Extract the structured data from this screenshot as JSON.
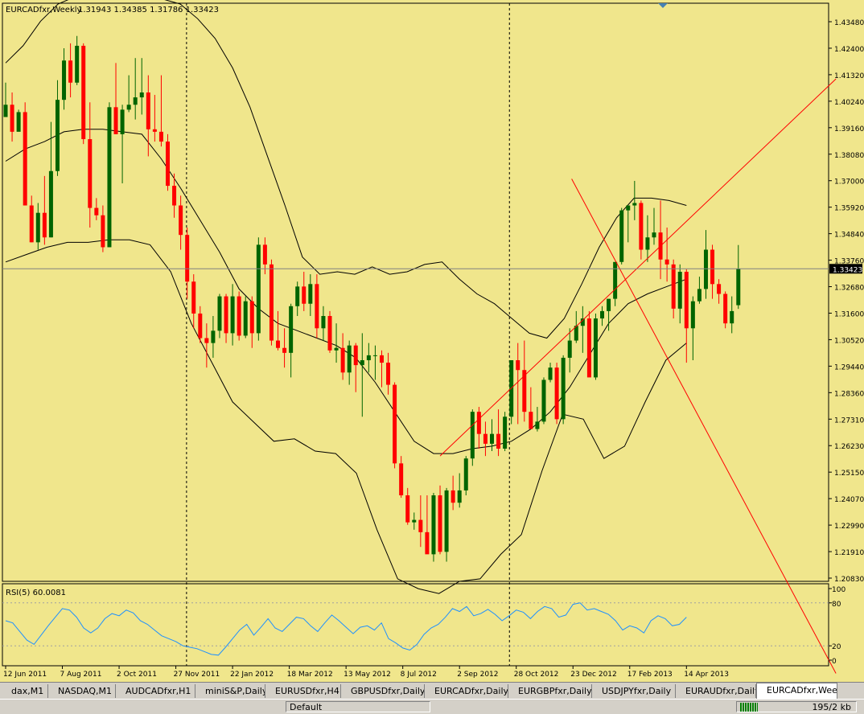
{
  "chart_header": {
    "symbol_text": "EURCADfxr,Weekly",
    "ohlc_text": "1.31943 1.34385 1.31786 1.33423"
  },
  "rsi_header": {
    "text": "RSI(5) 60.0081"
  },
  "current_price_label": "1.33423",
  "price_ticks": [
    "1.43480",
    "1.42400",
    "1.41320",
    "1.40240",
    "1.39160",
    "1.38080",
    "1.37000",
    "1.35920",
    "1.34840",
    "1.33760",
    "1.32680",
    "1.31600",
    "1.30520",
    "1.29440",
    "1.28360",
    "1.27310",
    "1.26230",
    "1.25150",
    "1.24070",
    "1.22990",
    "1.21910",
    "1.20830"
  ],
  "rsi_ticks": [
    "100",
    "80",
    "20",
    "0"
  ],
  "date_ticks": [
    "12 Jun 2011",
    "7 Aug 2011",
    "2 Oct 2011",
    "27 Nov 2011",
    "22 Jan 2012",
    "18 Mar 2012",
    "13 May 2012",
    "8 Jul 2012",
    "2 Sep 2012",
    "28 Oct 2012",
    "23 Dec 2012",
    "17 Feb 2013",
    "14 Apr 2013"
  ],
  "tabs": [
    "dax,M1",
    "NASDAQ,M1",
    "AUDCADfxr,H1",
    "miniS&P,Daily",
    "EURUSDfxr,H4",
    "GBPUSDfxr,Daily",
    "EURCADfxr,Daily",
    "EURGBPfxr,Daily",
    "USDJPYfxr,Daily",
    "EURAUDfxr,Daily",
    "EURCADfxr,Weekly"
  ],
  "active_tab": 10,
  "status": {
    "profile": "Default",
    "traffic": "195/2 kb"
  },
  "colors": {
    "background": "#f0e68c",
    "bull": "#006400",
    "bear": "#ff0000",
    "band": "#000000",
    "trendline": "#ff0000",
    "rsi": "#1e90ff"
  },
  "chart_data": {
    "type": "candlestick",
    "timeframe": "Weekly",
    "symbol": "EURCADfxr",
    "ylim": [
      1.2083,
      1.4348
    ],
    "candles": [
      [
        1.396,
        1.41,
        1.396,
        1.401
      ],
      [
        1.401,
        1.406,
        1.386,
        1.39
      ],
      [
        1.39,
        1.399,
        1.392,
        1.398
      ],
      [
        1.398,
        1.402,
        1.36,
        1.36
      ],
      [
        1.36,
        1.364,
        1.345,
        1.345
      ],
      [
        1.345,
        1.361,
        1.342,
        1.357
      ],
      [
        1.357,
        1.372,
        1.344,
        1.347
      ],
      [
        1.347,
        1.394,
        1.347,
        1.374
      ],
      [
        1.374,
        1.411,
        1.372,
        1.403
      ],
      [
        1.403,
        1.424,
        1.399,
        1.419
      ],
      [
        1.419,
        1.426,
        1.404,
        1.41
      ],
      [
        1.41,
        1.429,
        1.409,
        1.425
      ],
      [
        1.425,
        1.426,
        1.385,
        1.387
      ],
      [
        1.387,
        1.402,
        1.351,
        1.359
      ],
      [
        1.359,
        1.363,
        1.354,
        1.356
      ],
      [
        1.356,
        1.36,
        1.341,
        1.343
      ],
      [
        1.343,
        1.402,
        1.343,
        1.4
      ],
      [
        1.4,
        1.418,
        1.389,
        1.389
      ],
      [
        1.389,
        1.401,
        1.369,
        1.399
      ],
      [
        1.399,
        1.413,
        1.398,
        1.401
      ],
      [
        1.401,
        1.42,
        1.395,
        1.404
      ],
      [
        1.404,
        1.42,
        1.397,
        1.406
      ],
      [
        1.406,
        1.413,
        1.38,
        1.391
      ],
      [
        1.391,
        1.405,
        1.386,
        1.39
      ],
      [
        1.39,
        1.413,
        1.384,
        1.386
      ],
      [
        1.386,
        1.389,
        1.366,
        1.368
      ],
      [
        1.368,
        1.373,
        1.355,
        1.36
      ],
      [
        1.36,
        1.364,
        1.342,
        1.348
      ],
      [
        1.348,
        1.351,
        1.322,
        1.329
      ],
      [
        1.329,
        1.332,
        1.31,
        1.316
      ],
      [
        1.316,
        1.319,
        1.304,
        1.306
      ],
      [
        1.306,
        1.312,
        1.294,
        1.304
      ],
      [
        1.304,
        1.315,
        1.298,
        1.309
      ],
      [
        1.309,
        1.324,
        1.306,
        1.323
      ],
      [
        1.323,
        1.324,
        1.304,
        1.308
      ],
      [
        1.308,
        1.328,
        1.303,
        1.323
      ],
      [
        1.323,
        1.325,
        1.305,
        1.307
      ],
      [
        1.307,
        1.323,
        1.306,
        1.321
      ],
      [
        1.321,
        1.323,
        1.302,
        1.308
      ],
      [
        1.308,
        1.347,
        1.305,
        1.344
      ],
      [
        1.344,
        1.347,
        1.332,
        1.336
      ],
      [
        1.336,
        1.338,
        1.303,
        1.305
      ],
      [
        1.305,
        1.317,
        1.301,
        1.302
      ],
      [
        1.302,
        1.31,
        1.294,
        1.3
      ],
      [
        1.3,
        1.32,
        1.29,
        1.319
      ],
      [
        1.319,
        1.329,
        1.315,
        1.327
      ],
      [
        1.327,
        1.333,
        1.317,
        1.32
      ],
      [
        1.32,
        1.332,
        1.315,
        1.328
      ],
      [
        1.328,
        1.332,
        1.306,
        1.31
      ],
      [
        1.31,
        1.319,
        1.305,
        1.315
      ],
      [
        1.315,
        1.317,
        1.3,
        1.301
      ],
      [
        1.301,
        1.312,
        1.296,
        1.302
      ],
      [
        1.302,
        1.308,
        1.289,
        1.292
      ],
      [
        1.292,
        1.305,
        1.287,
        1.303
      ],
      [
        1.303,
        1.304,
        1.284,
        1.295
      ],
      [
        1.295,
        1.308,
        1.274,
        1.297
      ],
      [
        1.297,
        1.304,
        1.292,
        1.299
      ],
      [
        1.299,
        1.303,
        1.289,
        1.299
      ],
      [
        1.299,
        1.301,
        1.286,
        1.296
      ],
      [
        1.296,
        1.3,
        1.283,
        1.287
      ],
      [
        1.287,
        1.288,
        1.253,
        1.255
      ],
      [
        1.255,
        1.258,
        1.241,
        1.242
      ],
      [
        1.242,
        1.245,
        1.23,
        1.231
      ],
      [
        1.231,
        1.235,
        1.228,
        1.232
      ],
      [
        1.232,
        1.242,
        1.221,
        1.227
      ],
      [
        1.227,
        1.242,
        1.22,
        1.218
      ],
      [
        1.218,
        1.243,
        1.215,
        1.242
      ],
      [
        1.242,
        1.246,
        1.218,
        1.219
      ],
      [
        1.219,
        1.245,
        1.215,
        1.244
      ],
      [
        1.244,
        1.25,
        1.236,
        1.239
      ],
      [
        1.239,
        1.251,
        1.237,
        1.244
      ],
      [
        1.244,
        1.258,
        1.242,
        1.257
      ],
      [
        1.257,
        1.277,
        1.254,
        1.276
      ],
      [
        1.276,
        1.278,
        1.261,
        1.267
      ],
      [
        1.267,
        1.272,
        1.258,
        1.263
      ],
      [
        1.263,
        1.273,
        1.26,
        1.267
      ],
      [
        1.267,
        1.277,
        1.258,
        1.261
      ],
      [
        1.261,
        1.276,
        1.26,
        1.274
      ],
      [
        1.274,
        1.297,
        1.271,
        1.297
      ],
      [
        1.297,
        1.304,
        1.271,
        1.293
      ],
      [
        1.293,
        1.305,
        1.272,
        1.276
      ],
      [
        1.276,
        1.286,
        1.271,
        1.269
      ],
      [
        1.269,
        1.278,
        1.268,
        1.272
      ],
      [
        1.272,
        1.29,
        1.271,
        1.289
      ],
      [
        1.289,
        1.296,
        1.288,
        1.294
      ],
      [
        1.294,
        1.296,
        1.271,
        1.273
      ],
      [
        1.273,
        1.299,
        1.271,
        1.298
      ],
      [
        1.298,
        1.31,
        1.292,
        1.305
      ],
      [
        1.305,
        1.317,
        1.304,
        1.311
      ],
      [
        1.311,
        1.319,
        1.3,
        1.314
      ],
      [
        1.314,
        1.317,
        1.292,
        1.29
      ],
      [
        1.29,
        1.316,
        1.289,
        1.314
      ],
      [
        1.314,
        1.319,
        1.311,
        1.317
      ],
      [
        1.317,
        1.32,
        1.309,
        1.322
      ],
      [
        1.322,
        1.337,
        1.319,
        1.337
      ],
      [
        1.337,
        1.359,
        1.336,
        1.358
      ],
      [
        1.358,
        1.359,
        1.345,
        1.36
      ],
      [
        1.36,
        1.37,
        1.354,
        1.361
      ],
      [
        1.361,
        1.362,
        1.338,
        1.342
      ],
      [
        1.342,
        1.356,
        1.337,
        1.347
      ],
      [
        1.347,
        1.359,
        1.344,
        1.349
      ],
      [
        1.349,
        1.362,
        1.33,
        1.338
      ],
      [
        1.338,
        1.351,
        1.329,
        1.336
      ],
      [
        1.336,
        1.338,
        1.314,
        1.318
      ],
      [
        1.318,
        1.336,
        1.312,
        1.333
      ],
      [
        1.333,
        1.334,
        1.296,
        1.31
      ],
      [
        1.31,
        1.323,
        1.297,
        1.321
      ],
      [
        1.321,
        1.331,
        1.32,
        1.326
      ],
      [
        1.326,
        1.35,
        1.322,
        1.342
      ],
      [
        1.342,
        1.344,
        1.322,
        1.328
      ],
      [
        1.328,
        1.33,
        1.32,
        1.324
      ],
      [
        1.324,
        1.325,
        1.31,
        1.312
      ],
      [
        1.312,
        1.323,
        1.308,
        1.317
      ],
      [
        1.3194,
        1.3439,
        1.3179,
        1.3342
      ]
    ],
    "bollinger_upper": [
      1.418,
      1.425,
      1.435,
      1.442,
      1.445,
      1.448,
      1.448,
      1.447,
      1.446,
      1.444,
      1.442,
      1.436,
      1.428,
      1.416,
      1.4,
      1.38,
      1.36,
      1.339,
      1.332,
      1.333,
      1.332,
      1.335,
      1.332,
      1.333,
      1.336,
      1.337,
      1.33,
      1.324,
      1.32,
      1.314,
      1.308,
      1.306,
      1.314,
      1.328,
      1.343,
      1.355,
      1.363,
      1.363,
      1.362,
      1.36
    ],
    "bollinger_middle": [
      1.378,
      1.383,
      1.386,
      1.39,
      1.391,
      1.391,
      1.39,
      1.389,
      1.379,
      1.367,
      1.354,
      1.341,
      1.326,
      1.318,
      1.312,
      1.309,
      1.306,
      1.303,
      1.298,
      1.288,
      1.276,
      1.264,
      1.259,
      1.259,
      1.261,
      1.262,
      1.264,
      1.269,
      1.276,
      1.286,
      1.299,
      1.312,
      1.32,
      1.324,
      1.327,
      1.33
    ],
    "bollinger_lower": [
      1.337,
      1.34,
      1.343,
      1.345,
      1.345,
      1.346,
      1.346,
      1.344,
      1.333,
      1.312,
      1.296,
      1.28,
      1.272,
      1.264,
      1.265,
      1.26,
      1.259,
      1.251,
      1.228,
      1.208,
      1.204,
      1.202,
      1.207,
      1.208,
      1.218,
      1.226,
      1.252,
      1.275,
      1.273,
      1.257,
      1.262,
      1.28,
      1.297,
      1.304
    ],
    "trendlines": [
      {
        "t1": 87.3,
        "p1": 1.3708,
        "t2": 102.0,
        "p2": 1.2982
      },
      {
        "t1": 67.0,
        "p1": 1.258,
        "t2": 102.0,
        "p2": 1.346
      }
    ],
    "rsi_period": 5,
    "rsi_value": 60.0081,
    "rsi_levels": [
      80,
      20
    ],
    "rsi_ylim": [
      0,
      100
    ],
    "rsi_values": [
      55,
      52,
      40,
      28,
      22,
      35,
      48,
      60,
      72,
      70,
      60,
      45,
      38,
      45,
      58,
      65,
      62,
      70,
      66,
      55,
      50,
      42,
      34,
      30,
      26,
      20,
      18,
      16,
      12,
      8,
      7,
      18,
      30,
      42,
      50,
      35,
      46,
      58,
      45,
      40,
      50,
      60,
      58,
      48,
      40,
      52,
      63,
      55,
      46,
      37,
      46,
      48,
      42,
      52,
      30,
      24,
      17,
      14,
      22,
      36,
      45,
      50,
      60,
      72,
      68,
      75,
      62,
      65,
      71,
      64,
      55,
      62,
      70,
      67,
      58,
      68,
      75,
      72,
      60,
      63,
      78,
      80,
      70,
      72,
      68,
      64,
      55,
      42,
      48,
      45,
      38,
      55,
      62,
      58,
      48,
      50,
      60
    ],
    "current_price": 1.33423,
    "vertical_separators": [
      27.9,
      77.7
    ]
  }
}
